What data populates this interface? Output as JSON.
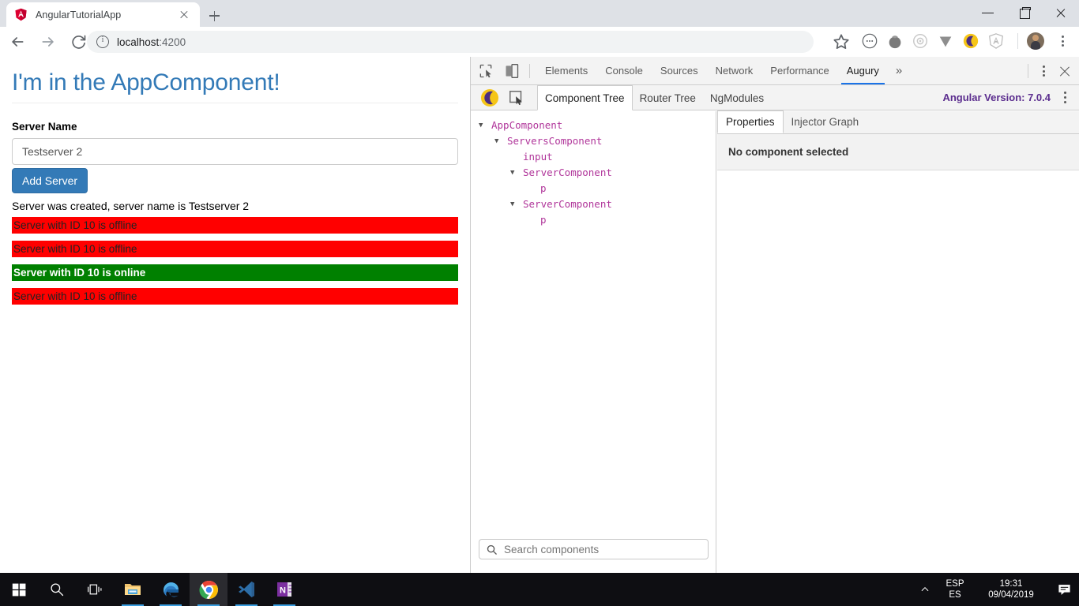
{
  "browser": {
    "tab": {
      "title": "AngularTutorialApp",
      "favicon": "angular-logo-icon",
      "close": "close-icon"
    },
    "newtab_label": "new-tab-button",
    "window_controls": [
      "minimize",
      "maximize",
      "close"
    ],
    "nav": {
      "back": "back-arrow-icon",
      "forward": "forward-arrow-icon",
      "reload": "reload-icon"
    },
    "omnibox": {
      "info_icon": "site-info-icon",
      "host": "localhost",
      "port": ":4200"
    },
    "star": "bookmark-star-icon",
    "extensions": [
      "dots-circle-icon",
      "tomato-icon",
      "target-icon",
      "v-icon",
      "augury-moon-icon",
      "angular-icon"
    ],
    "profile": "avatar",
    "menu": "chrome-menu-icon"
  },
  "page": {
    "heading": "I'm in the AppComponent!",
    "label": "Server Name",
    "input_value": "Testserver 2",
    "input_placeholder": "",
    "button": "Add Server",
    "created_message": "Server was created, server name is Testserver 2",
    "servers": [
      {
        "text": "Server with ID 10 is offline",
        "status": "offline"
      },
      {
        "text": "Server with ID 10 is offline",
        "status": "offline"
      },
      {
        "text": "Server with ID 10 is online",
        "status": "online"
      },
      {
        "text": "Server with ID 10 is offline",
        "status": "offline"
      }
    ],
    "colors": {
      "heading": "#337ab7",
      "offline": "#ff0000",
      "online": "#008000",
      "button": "#337ab7"
    }
  },
  "devtools": {
    "inspect_icon": "inspect-element-icon",
    "device_icon": "device-toolbar-icon",
    "tabs": [
      {
        "label": "Elements",
        "active": false
      },
      {
        "label": "Console",
        "active": false
      },
      {
        "label": "Sources",
        "active": false
      },
      {
        "label": "Network",
        "active": false
      },
      {
        "label": "Performance",
        "active": false
      },
      {
        "label": "Augury",
        "active": true
      }
    ],
    "overflow": "»",
    "menu": "devtools-menu-icon",
    "close": "devtools-close-icon",
    "accent": "#1a73e8"
  },
  "augury": {
    "moon_icon": "augury-moon-icon",
    "inspect_icon": "augury-inspect-icon",
    "tabs": [
      {
        "label": "Component Tree",
        "active": true
      },
      {
        "label": "Router Tree",
        "active": false
      },
      {
        "label": "NgModules",
        "active": false
      }
    ],
    "version_label": "Angular Version: 7.0.4",
    "version_color": "#5b2d8e",
    "menu": "augury-menu-icon",
    "tree": [
      {
        "label": "AppComponent",
        "depth": 0,
        "expandable": true
      },
      {
        "label": "ServersComponent",
        "depth": 1,
        "expandable": true
      },
      {
        "label": "input",
        "depth": 2,
        "expandable": false
      },
      {
        "label": "ServerComponent",
        "depth": 2,
        "expandable": true
      },
      {
        "label": "p",
        "depth": 3,
        "expandable": false
      },
      {
        "label": "ServerComponent",
        "depth": 2,
        "expandable": true
      },
      {
        "label": "p",
        "depth": 3,
        "expandable": false
      }
    ],
    "search": {
      "icon": "search-icon",
      "placeholder": "Search components",
      "value": ""
    },
    "properties": {
      "tabs": [
        {
          "label": "Properties",
          "active": true
        },
        {
          "label": "Injector Graph",
          "active": false
        }
      ],
      "empty_message": "No component selected"
    }
  },
  "taskbar": {
    "items": [
      {
        "name": "start-button",
        "running": false,
        "active": false
      },
      {
        "name": "search-button",
        "running": false,
        "active": false
      },
      {
        "name": "task-view-button",
        "running": false,
        "active": false
      },
      {
        "name": "file-explorer",
        "running": true,
        "active": false
      },
      {
        "name": "microsoft-edge",
        "running": true,
        "active": false
      },
      {
        "name": "google-chrome",
        "running": true,
        "active": true
      },
      {
        "name": "visual-studio-code",
        "running": true,
        "active": false
      },
      {
        "name": "onenote",
        "running": true,
        "active": false
      }
    ],
    "tray": {
      "chevron": "show-hidden-icons",
      "lang_top": "ESP",
      "lang_bottom": "ES",
      "time": "19:31",
      "date": "09/04/2019",
      "action_center": "action-center-icon"
    }
  }
}
